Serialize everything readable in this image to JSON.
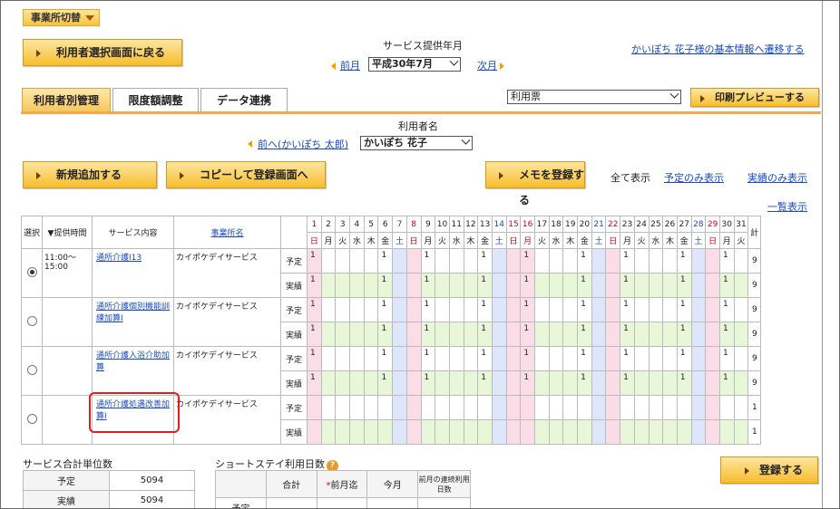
{
  "top": {
    "office_switch": "事業所切替"
  },
  "back_button": "利用者選択画面に戻る",
  "month": {
    "label": "サービス提供年月",
    "prev": "前月",
    "value": "平成30年7月",
    "next": "次月"
  },
  "basic_info_link": "かいぽち 花子様の基本情報へ遷移する",
  "tabs": [
    "利用者別管理",
    "限度額調整",
    "データ連携"
  ],
  "form_select": "利用票",
  "print_button": "印刷プレビューする",
  "user": {
    "label": "利用者名",
    "prev": "前へ(かいぽち 太郎)",
    "value": "かいぽち 花子"
  },
  "buttons": {
    "new": "新規追加する",
    "copy": "コピーして登録画面へ",
    "memo": "メモを登録する",
    "register": "登録する"
  },
  "filters": {
    "all": "全て表示",
    "plan": "予定のみ表示",
    "actual": "実績のみ表示",
    "list": "一覧表示"
  },
  "table": {
    "col_select": "選択",
    "col_time": "▼提供時間",
    "col_service": "サービス内容",
    "col_office": "事業所名",
    "col_total": "計",
    "days": [
      "1",
      "2",
      "3",
      "4",
      "5",
      "6",
      "7",
      "8",
      "9",
      "10",
      "11",
      "12",
      "13",
      "14",
      "15",
      "16",
      "17",
      "18",
      "19",
      "20",
      "21",
      "22",
      "23",
      "24",
      "25",
      "26",
      "27",
      "28",
      "29",
      "30",
      "31"
    ],
    "weekdays": [
      "日",
      "月",
      "火",
      "水",
      "木",
      "金",
      "土",
      "日",
      "月",
      "火",
      "水",
      "木",
      "金",
      "土",
      "日",
      "月",
      "火",
      "水",
      "木",
      "金",
      "土",
      "日",
      "月",
      "火",
      "水",
      "木",
      "金",
      "土",
      "日",
      "月",
      "火"
    ],
    "holiday_days": [
      16
    ],
    "plan_label": "予定",
    "actual_label": "実績",
    "rows": [
      {
        "time": "11:00～\n15:00",
        "selected": true,
        "service": "通所介護Ⅰ13",
        "office": "カイポケデイサービス",
        "plan": {
          "1": "1",
          "6": "1",
          "9": "1",
          "13": "1",
          "16": "1",
          "20": "1",
          "23": "1",
          "27": "1",
          "30": "1"
        },
        "plan_total": "9",
        "actual": {
          "1": "1",
          "6": "1",
          "9": "1",
          "13": "1",
          "16": "1",
          "20": "1",
          "23": "1",
          "27": "1",
          "30": "1"
        },
        "actual_total": "9"
      },
      {
        "time": "",
        "selected": false,
        "service": "通所介護個別機能訓練加算Ⅰ",
        "office": "カイポケデイサービス",
        "plan": {
          "1": "1",
          "6": "1",
          "9": "1",
          "13": "1",
          "16": "1",
          "20": "1",
          "23": "1",
          "27": "1",
          "30": "1"
        },
        "plan_total": "9",
        "actual": {
          "1": "1",
          "6": "1",
          "9": "1",
          "13": "1",
          "16": "1",
          "20": "1",
          "23": "1",
          "27": "1",
          "30": "1"
        },
        "actual_total": "9"
      },
      {
        "time": "",
        "selected": false,
        "service": "通所介護入浴介助加算",
        "office": "カイポケデイサービス",
        "plan": {
          "1": "1",
          "6": "1",
          "9": "1",
          "13": "1",
          "16": "1",
          "20": "1",
          "23": "1",
          "27": "1",
          "30": "1"
        },
        "plan_total": "9",
        "actual": {
          "1": "1",
          "6": "1",
          "9": "1",
          "13": "1",
          "16": "1",
          "20": "1",
          "23": "1",
          "27": "1",
          "30": "1"
        },
        "actual_total": "9"
      },
      {
        "time": "",
        "selected": false,
        "service": "通所介護処遇改善加算Ⅰ",
        "office": "カイポケデイサービス",
        "plan": {},
        "plan_total": "1",
        "actual": {},
        "actual_total": "1"
      }
    ]
  },
  "summary": {
    "title": "サービス合計単位数",
    "plan_label": "予定",
    "plan_value": "5094",
    "actual_label": "実績",
    "actual_value": "5094"
  },
  "shortstay": {
    "title": "ショートステイ利用日数",
    "cols": [
      "合計",
      "前月迄",
      "今月",
      "前月の連続利用日数"
    ],
    "row_label": "予定"
  }
}
